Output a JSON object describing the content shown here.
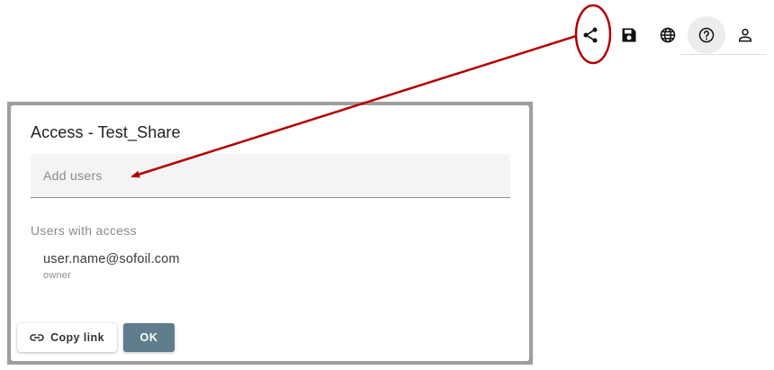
{
  "toolbar": {
    "icons": [
      "share-icon",
      "save-icon",
      "globe-icon",
      "help-icon",
      "account-icon"
    ],
    "active": "help-icon"
  },
  "dialog": {
    "title": "Access - Test_Share",
    "add_users_placeholder": "Add users",
    "section_label": "Users with access",
    "users": [
      {
        "email": "user.name@sofoil.com",
        "role": "owner"
      }
    ],
    "copy_link_label": "Copy link",
    "ok_label": "OK"
  },
  "annotation_color": "#b30000",
  "colors": {
    "ok_button": "#5f7d8c",
    "input_background": "#f4f4f4"
  }
}
